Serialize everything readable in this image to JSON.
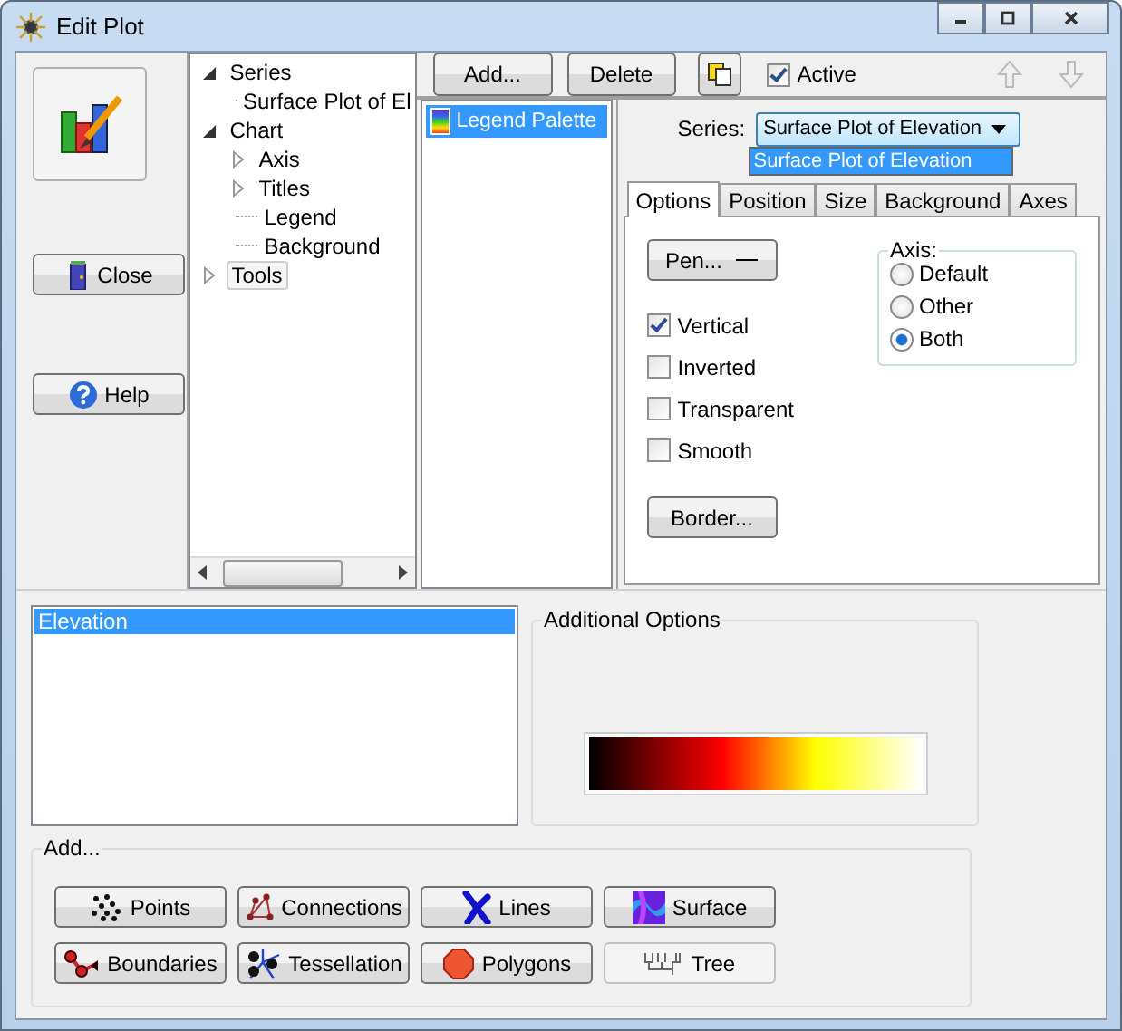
{
  "window": {
    "title": "Edit Plot"
  },
  "left": {
    "close_button": "Close",
    "help_button": "Help"
  },
  "tree": [
    {
      "label": "Series",
      "expanded": true,
      "selected": false,
      "children": [
        {
          "label": "Surface Plot of El",
          "selected": false
        }
      ]
    },
    {
      "label": "Chart",
      "expanded": true,
      "selected": false,
      "children": [
        {
          "label": "Axis",
          "expanded": false,
          "selected": false
        },
        {
          "label": "Titles",
          "expanded": false,
          "selected": false
        },
        {
          "label": "Legend",
          "selected": false
        },
        {
          "label": "Background",
          "selected": false
        }
      ]
    },
    {
      "label": "Tools",
      "expanded": false,
      "selected": true
    }
  ],
  "toolbar": {
    "add_button": "Add...",
    "delete_button": "Delete",
    "active": {
      "label": "Active",
      "checked": true
    }
  },
  "tools_list": [
    {
      "label": "Legend Palette",
      "selected": true
    }
  ],
  "series": {
    "label": "Series:",
    "value": "Surface Plot of Elevation",
    "options": [
      {
        "label": "Surface Plot of Elevation",
        "selected": true
      }
    ]
  },
  "tabs": [
    {
      "label": "Options",
      "selected": true
    },
    {
      "label": "Position",
      "selected": false
    },
    {
      "label": "Size",
      "selected": false
    },
    {
      "label": "Background",
      "selected": false
    },
    {
      "label": "Axes",
      "selected": false
    }
  ],
  "options": {
    "pen_button": "Pen...",
    "checkboxes": [
      {
        "label": "Vertical",
        "checked": true
      },
      {
        "label": "Inverted",
        "checked": false
      },
      {
        "label": "Transparent",
        "checked": false
      },
      {
        "label": "Smooth",
        "checked": false
      }
    ],
    "border_button": "Border...",
    "axis": {
      "title": "Axis:",
      "radios": [
        {
          "label": "Default",
          "selected": false
        },
        {
          "label": "Other",
          "selected": false
        },
        {
          "label": "Both",
          "selected": true
        }
      ]
    }
  },
  "values_list": [
    {
      "label": "Elevation",
      "selected": true
    }
  ],
  "additional_options": {
    "title": "Additional Options"
  },
  "add_group": {
    "title": "Add...",
    "buttons": [
      {
        "label": "Points",
        "kind": "points",
        "disabled": false
      },
      {
        "label": "Connections",
        "kind": "connections",
        "disabled": false
      },
      {
        "label": "Lines",
        "kind": "lines",
        "disabled": false
      },
      {
        "label": "Surface",
        "kind": "surface",
        "disabled": false
      },
      {
        "label": "Boundaries",
        "kind": "boundaries",
        "disabled": false
      },
      {
        "label": "Tessellation",
        "kind": "tessellation",
        "disabled": false
      },
      {
        "label": "Polygons",
        "kind": "polygons",
        "disabled": false
      },
      {
        "label": "Tree",
        "kind": "tree",
        "disabled": true
      }
    ]
  }
}
